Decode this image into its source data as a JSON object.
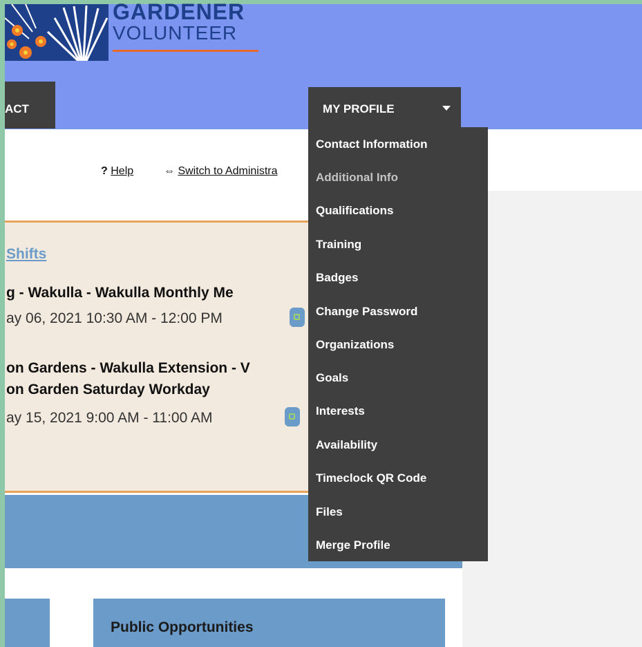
{
  "logo": {
    "line1": "GARDENER",
    "line2": "VOLUNTEER"
  },
  "nav": {
    "contact_label": "ACT",
    "profile_label": "MY PROFILE"
  },
  "toplinks": {
    "help": "Help",
    "help_prefix": "?",
    "switch": "Switch to Administra",
    "switch_prefix": "⇔"
  },
  "shifts": {
    "title": "Shifts",
    "events": [
      {
        "title": "g - Wakulla - Wakulla Monthly Me",
        "time": "ay 06, 2021 10:30 AM - 12:00 PM"
      },
      {
        "title_line1": "on Gardens - Wakulla Extension - V",
        "title_line2": "on Garden Saturday Workday",
        "time": "ay 15, 2021 9:00 AM - 11:00 AM"
      }
    ]
  },
  "sections": {
    "public_opportunities": "Public Opportunities"
  },
  "profile_menu": {
    "items": [
      {
        "label": "Contact Information"
      },
      {
        "label": "Additional Info"
      },
      {
        "label": "Qualifications"
      },
      {
        "label": "Training"
      },
      {
        "label": "Badges"
      },
      {
        "label": "Change Password"
      },
      {
        "label": "Organizations"
      },
      {
        "label": "Goals"
      },
      {
        "label": "Interests"
      },
      {
        "label": "Availability"
      },
      {
        "label": "Timeclock QR Code"
      },
      {
        "label": "Files"
      },
      {
        "label": "Merge Profile"
      }
    ]
  },
  "colors": {
    "header_bg": "#7b95f0",
    "nav_dark": "#3f3f3f",
    "accent_blue": "#6b9bc8",
    "accent_orange": "#e8692d",
    "shifts_bg": "#f3eadf",
    "logo_blue": "#1e3f8a"
  }
}
